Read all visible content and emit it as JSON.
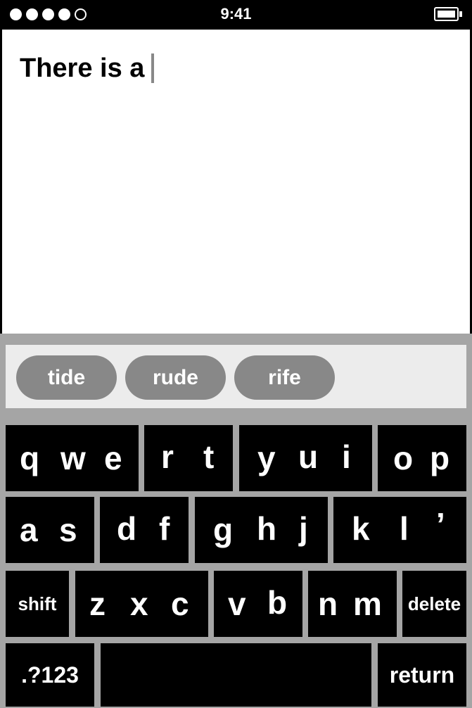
{
  "status_bar": {
    "time": "9:41",
    "signal_filled": 4,
    "signal_total": 5
  },
  "editor": {
    "text": "There is a"
  },
  "suggestions": [
    "tide",
    "rude",
    "rife"
  ],
  "keys": {
    "row1": [
      [
        "q",
        "w",
        "e"
      ],
      [
        "r",
        "t"
      ],
      [
        "y",
        "u",
        "i"
      ],
      [
        "o",
        "p"
      ]
    ],
    "row2": [
      [
        "a",
        "s"
      ],
      [
        "d",
        "f"
      ],
      [
        "g",
        "h",
        "j"
      ],
      [
        "k",
        "l",
        "’"
      ]
    ],
    "row3": [
      [
        "z",
        "x",
        "c"
      ],
      [
        "v",
        "b"
      ],
      [
        "n",
        "m"
      ]
    ],
    "shift": "shift",
    "delete": "delete",
    "numbers": ".?123",
    "return": "return"
  }
}
